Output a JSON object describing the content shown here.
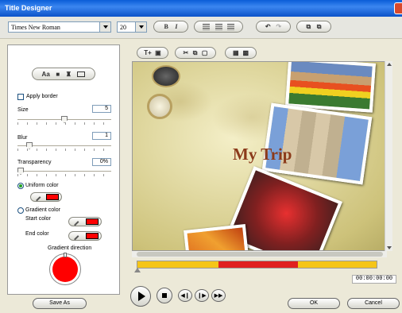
{
  "window": {
    "title": "Title Designer"
  },
  "toolbar": {
    "font_name": "Times New Roman",
    "font_size": "20",
    "bold_label": "B",
    "italic_label": "I"
  },
  "left_panel": {
    "tabs": [
      {
        "label": "Aa"
      },
      {
        "icon": "motion-icon"
      },
      {
        "icon": "background-icon"
      }
    ],
    "style_group": {
      "text_label": "Aa"
    },
    "apply_border": "Apply border",
    "size": {
      "label": "Size",
      "value": "5",
      "fraction": 0.5
    },
    "blur": {
      "label": "Blur",
      "value": "1",
      "fraction": 0.1
    },
    "transparency": {
      "label": "Transparency",
      "value": "0%",
      "fraction": 0.0
    },
    "uniform_color": {
      "label": "Uniform color",
      "color": "#ff0000"
    },
    "gradient_color": {
      "label": "Gradient color"
    },
    "start_color": {
      "label": "Start color",
      "color": "#ff0000"
    },
    "end_color": {
      "label": "End color",
      "color": "#ff0000"
    },
    "gradient_direction": {
      "label": "Gradient direction",
      "color": "#ff0000"
    },
    "save_as": "Save As"
  },
  "preview": {
    "title_text": "My Trip",
    "title_color": "#8b3a1a"
  },
  "playback": {
    "timecode": "00:00:00:00",
    "timeline_colors": {
      "normal": "#f5c518",
      "selected": "#e02020"
    }
  },
  "buttons": {
    "ok": "OK",
    "cancel": "Cancel"
  }
}
